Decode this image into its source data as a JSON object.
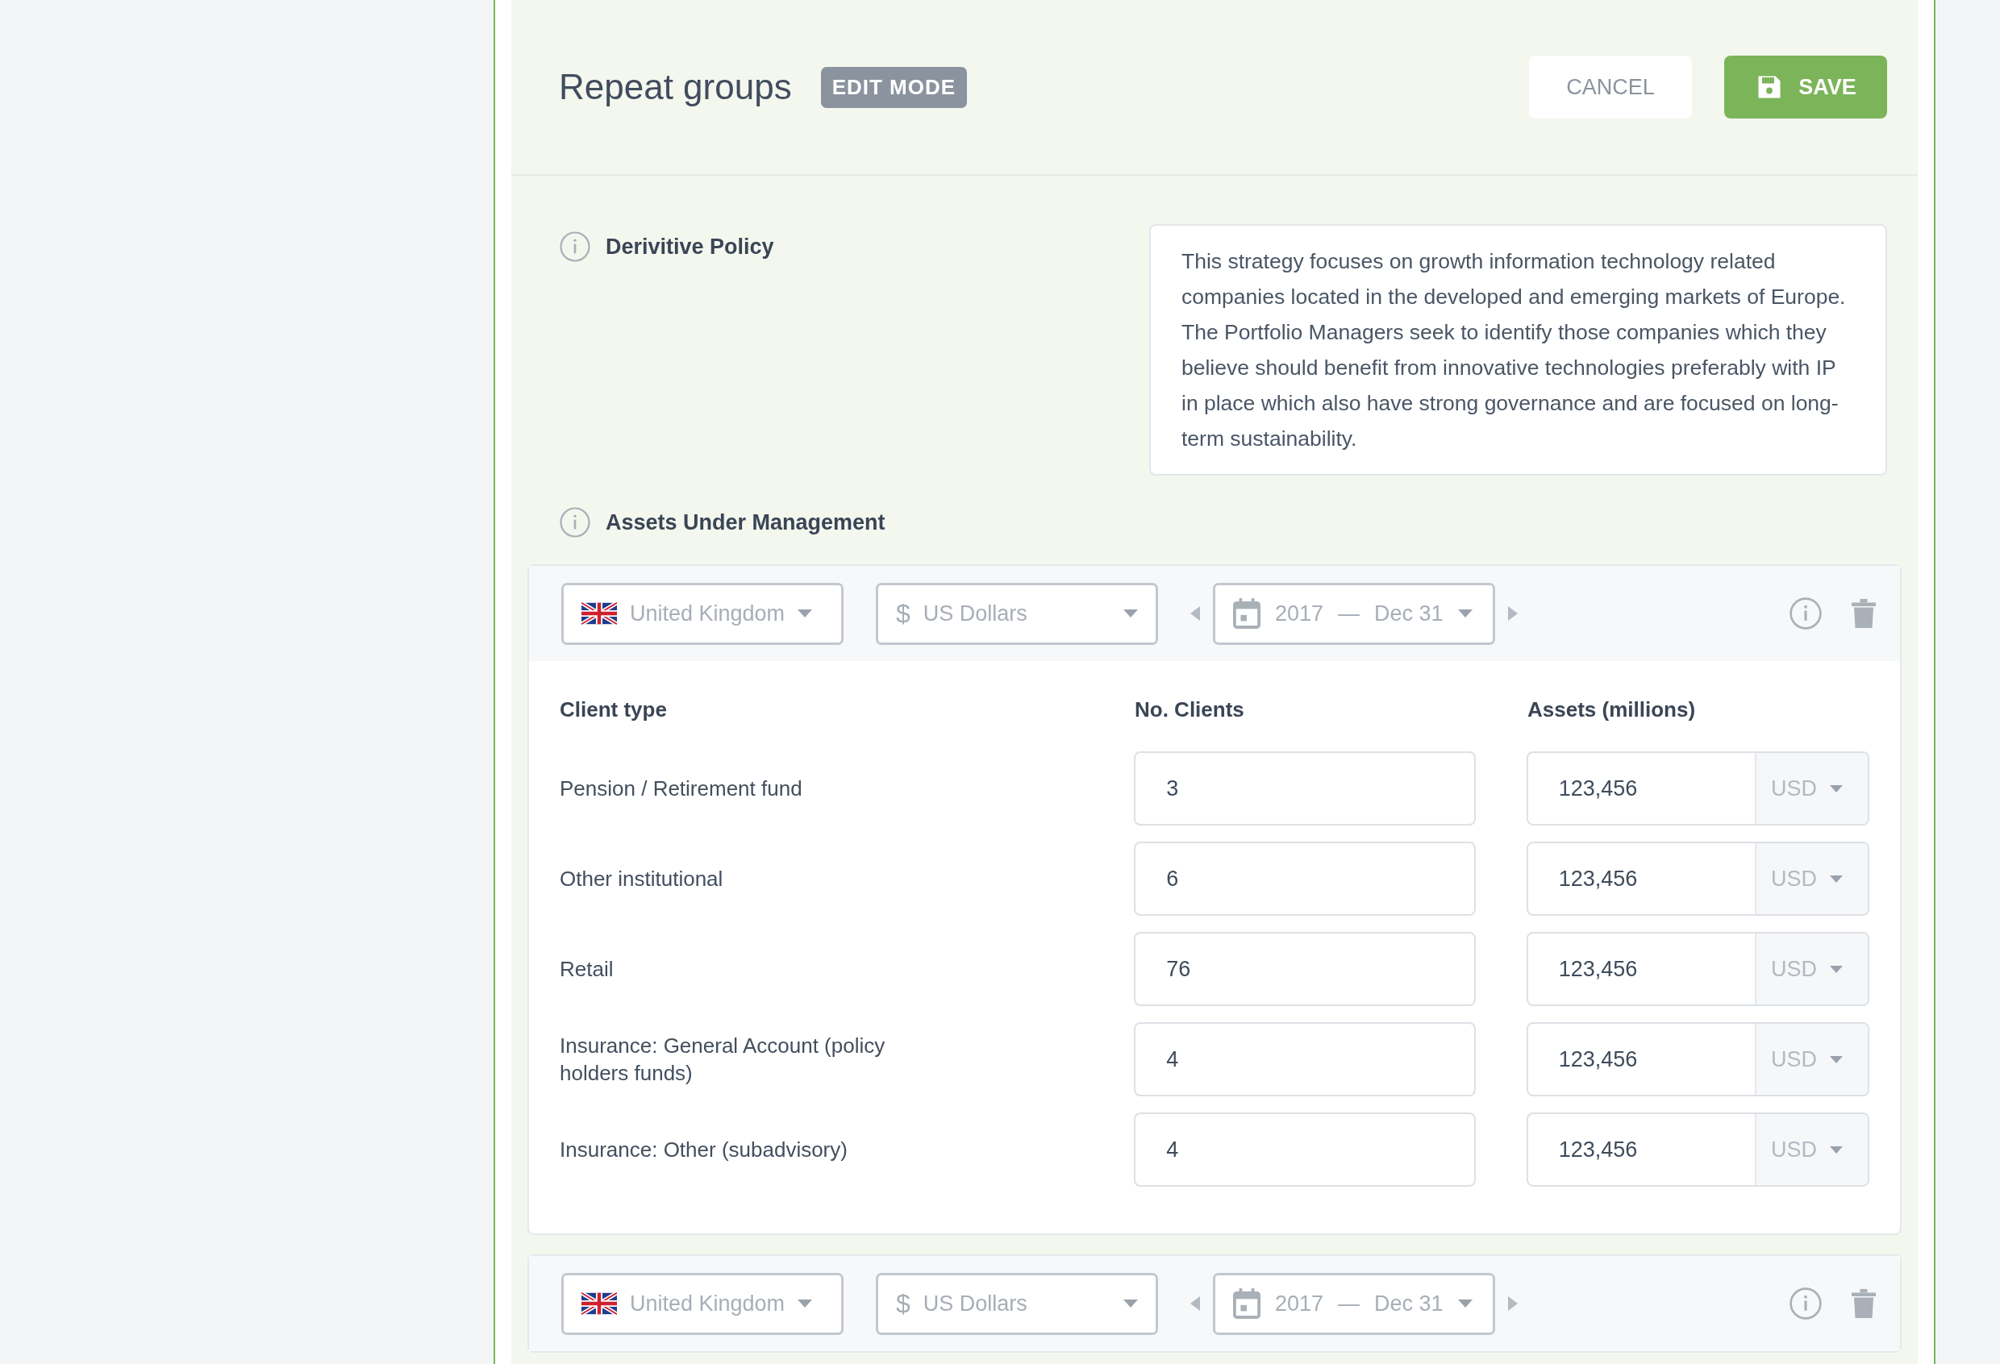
{
  "header": {
    "title": "Repeat groups",
    "badge": "EDIT MODE",
    "cancel": "CANCEL",
    "save": "SAVE"
  },
  "policy": {
    "label": "Derivitive Policy",
    "text": "This strategy focuses on growth information technology related companies located in the developed and emerging markets of Europe. The Portfolio Managers seek to identify those companies which they believe should benefit from innovative technologies preferably with IP in place which also have strong governance and are focused on long-term sustainability."
  },
  "aum": {
    "label": "Assets Under Management",
    "groups": [
      {
        "country": "United Kingdom",
        "currency_symbol": "$",
        "currency": "US Dollars",
        "year": "2017",
        "dash": "—",
        "date": "Dec 31",
        "columns": [
          "Client type",
          "No. Clients",
          "Assets (millions)"
        ],
        "rows": [
          {
            "client_type": "Pension / Retirement fund",
            "clients": "3",
            "assets": "123,456",
            "unit": "USD"
          },
          {
            "client_type": "Other institutional",
            "clients": "6",
            "assets": "123,456",
            "unit": "USD"
          },
          {
            "client_type": "Retail",
            "clients": "76",
            "assets": "123,456",
            "unit": "USD"
          },
          {
            "client_type": "Insurance: General Account (policy holders funds)",
            "clients": "4",
            "assets": "123,456",
            "unit": "USD"
          },
          {
            "client_type": "Insurance: Other (subadvisory)",
            "clients": "4",
            "assets": "123,456",
            "unit": "USD"
          }
        ]
      },
      {
        "country": "United Kingdom",
        "currency_symbol": "$",
        "currency": "US Dollars",
        "year": "2017",
        "dash": "—",
        "date": "Dec 31"
      }
    ]
  }
}
